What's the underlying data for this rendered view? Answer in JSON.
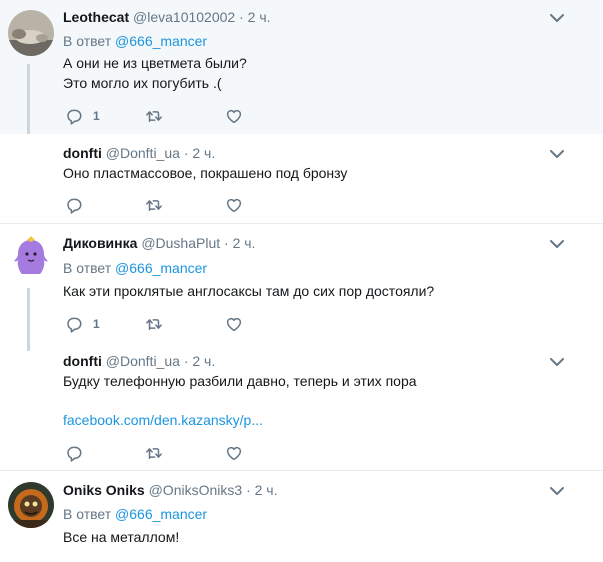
{
  "tweets": [
    {
      "name": "Leothecat",
      "handle": "@leva10102002",
      "time": "2 ч.",
      "reply_label": "В ответ",
      "reply_to": "@666_mancer",
      "line1": "А они не из цветмета были?",
      "line2": "Это могло их погубить .(",
      "replies": "1"
    },
    {
      "name": "donfti",
      "handle": "@Donfti_ua",
      "time": "2 ч.",
      "line1": "Оно пластмассовое, покрашено под бронзу"
    },
    {
      "name": "Диковинка",
      "handle": "@DushaPlut",
      "time": "2 ч.",
      "reply_label": "В ответ",
      "reply_to": "@666_mancer",
      "line1": "Как эти проклятые англосаксы там до сих пор достояли?",
      "replies": "1"
    },
    {
      "name": "donfti",
      "handle": "@Donfti_ua",
      "time": "2 ч.",
      "line1": "Будку телефонную разбили давно, теперь и этих пора",
      "link": "facebook.com/den.kazansky/p..."
    },
    {
      "name": "Oniks Oniks",
      "handle": "@OniksOniks3",
      "time": "2 ч.",
      "reply_label": "В ответ",
      "reply_to": "@666_mancer",
      "line1": "Все на металлом!"
    }
  ],
  "separator": "·",
  "icons": {
    "reply": "reply-icon",
    "retweet": "retweet-icon",
    "like": "like-icon",
    "menu": "chevron-down-icon"
  },
  "colors": {
    "highlight_bg": "#f5f8fa",
    "link": "#1b95e0",
    "muted": "#657786",
    "separator": "#e6ecf0"
  }
}
